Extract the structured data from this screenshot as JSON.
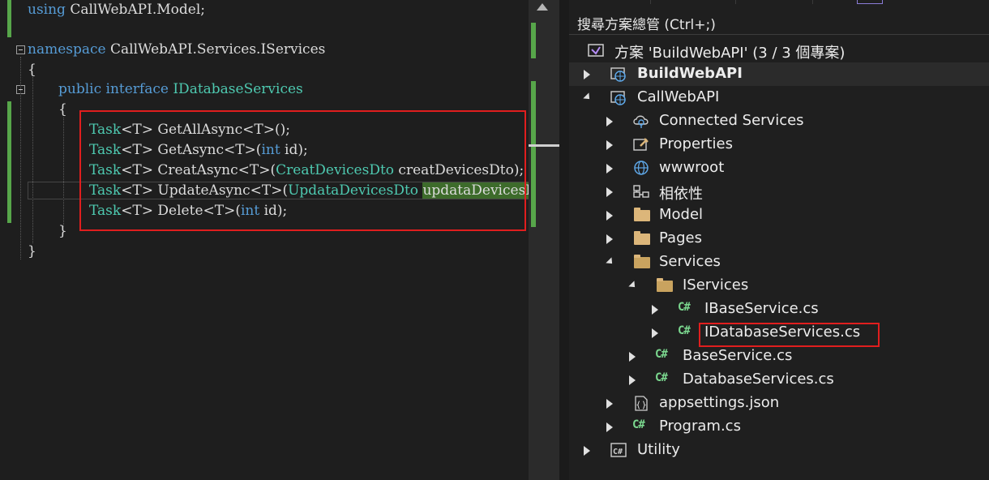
{
  "editor": {
    "lines": {
      "l1": {
        "kw": "using",
        "rest": " CallWebAPI.Model;"
      },
      "l3": {
        "kw": "namespace",
        "rest": " CallWebAPI.Services.IServices"
      },
      "l4": "{",
      "l5": {
        "kw1": "public",
        "kw2": "interface",
        "name": "IDatabaseServices"
      },
      "l6": "{",
      "m1": {
        "task": "Task",
        "gen": "<T>",
        "name": " GetAllAsync",
        "gen2": "<T>",
        "args": "();"
      },
      "m2": {
        "task": "Task",
        "gen": "<T>",
        "name": " GetAsync",
        "gen2": "<T>",
        "open": "(",
        "kw": "int",
        "args": " id);"
      },
      "m3": {
        "task": "Task",
        "gen": "<T>",
        "name": " CreatAsync",
        "gen2": "<T>",
        "open": "(",
        "ptype": "CreatDevicesDto",
        "pname": " creatDevicesDto",
        "close": ");"
      },
      "m4": {
        "task": "Task",
        "gen": "<T>",
        "name": " UpdateAsync",
        "gen2": "<T>",
        "open": "(",
        "ptype": "UpdataDevicesDto",
        "sp": " ",
        "pname": "updataDevicesDto",
        "close": ")"
      },
      "m5": {
        "task": "Task",
        "gen": "<T>",
        "name": " Delete",
        "gen2": "<T>",
        "open": "(",
        "kw": "int",
        "args": " id);"
      },
      "l12": "}",
      "l13": "}"
    }
  },
  "solution_explorer": {
    "search_placeholder": "搜尋方案總管 (Ctrl+;)",
    "items": [
      {
        "label": "方案 'BuildWebAPI' (3 / 3 個專案)",
        "icon": "solution-icon"
      },
      {
        "label": "BuildWebAPI",
        "icon": "web-project-icon",
        "bold": true
      },
      {
        "label": "CallWebAPI",
        "icon": "web-project-icon"
      },
      {
        "label": "Connected Services",
        "icon": "connected-services-icon"
      },
      {
        "label": "Properties",
        "icon": "properties-icon"
      },
      {
        "label": "wwwroot",
        "icon": "globe-icon"
      },
      {
        "label": "相依性",
        "icon": "dependencies-icon"
      },
      {
        "label": "Model",
        "icon": "folder-icon"
      },
      {
        "label": "Pages",
        "icon": "folder-icon"
      },
      {
        "label": "Services",
        "icon": "folder-open-icon"
      },
      {
        "label": "IServices",
        "icon": "folder-open-icon"
      },
      {
        "label": "IBaseService.cs",
        "icon": "csharp-file-icon"
      },
      {
        "label": "IDatabaseServices.cs",
        "icon": "csharp-file-icon"
      },
      {
        "label": "BaseService.cs",
        "icon": "csharp-file-icon"
      },
      {
        "label": "DatabaseServices.cs",
        "icon": "csharp-file-icon"
      },
      {
        "label": "appsettings.json",
        "icon": "json-file-icon"
      },
      {
        "label": "Program.cs",
        "icon": "csharp-file-icon"
      },
      {
        "label": "Utility",
        "icon": "csharp-project-icon"
      }
    ],
    "cs_glyph": "C#"
  },
  "colors": {
    "accent_green": "#57a64a",
    "highlight_red": "#e01e1e",
    "keyword": "#569cd6",
    "type": "#4ec9b0"
  }
}
